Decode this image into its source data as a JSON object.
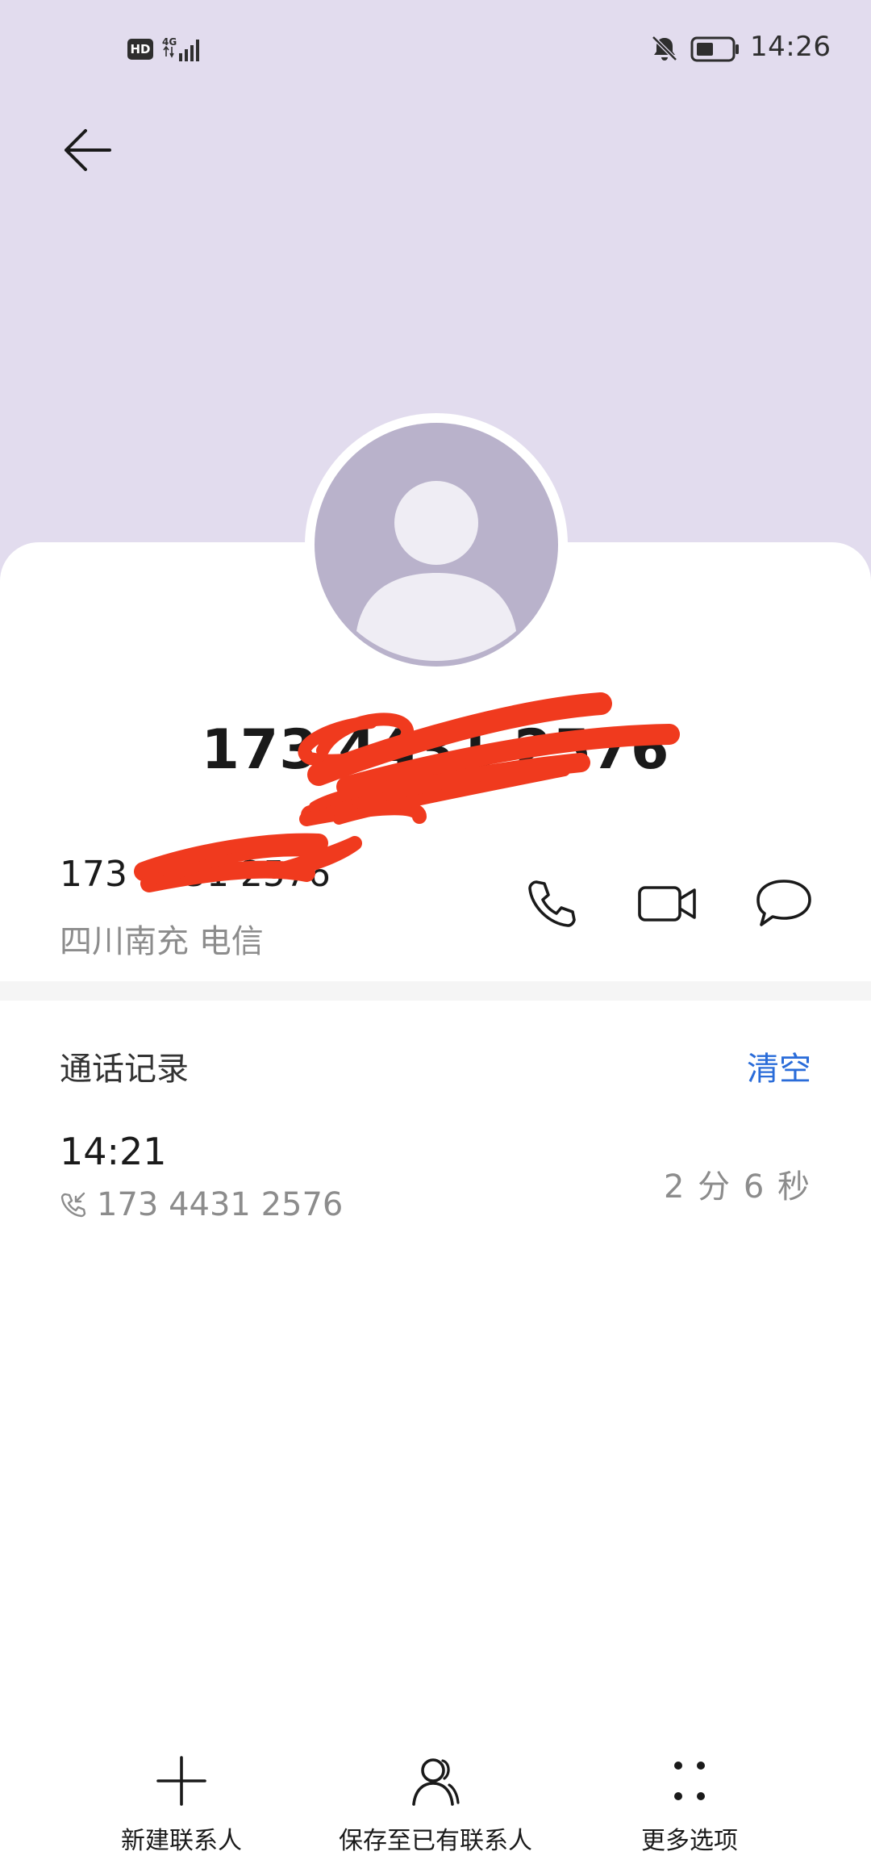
{
  "status_bar": {
    "hd_label": "HD",
    "network_label": "4G",
    "time": "14:26"
  },
  "contact": {
    "display_number": "173 4431 2576",
    "number_line": "173 4431 2576",
    "location": "四川南充 电信"
  },
  "call_log": {
    "title": "通话记录",
    "clear_label": "清空",
    "records": [
      {
        "time": "14:21",
        "number": "173 4431 2576",
        "duration": "2 分 6 秒"
      }
    ]
  },
  "bottom_bar": {
    "new_contact": "新建联系人",
    "save_existing": "保存至已有联系人",
    "more_options": "更多选项"
  },
  "colors": {
    "header_bg": "#e2dcee",
    "avatar_bg": "#b9b2cb",
    "accent": "#2a6cd9",
    "redaction": "#f03a1e"
  }
}
